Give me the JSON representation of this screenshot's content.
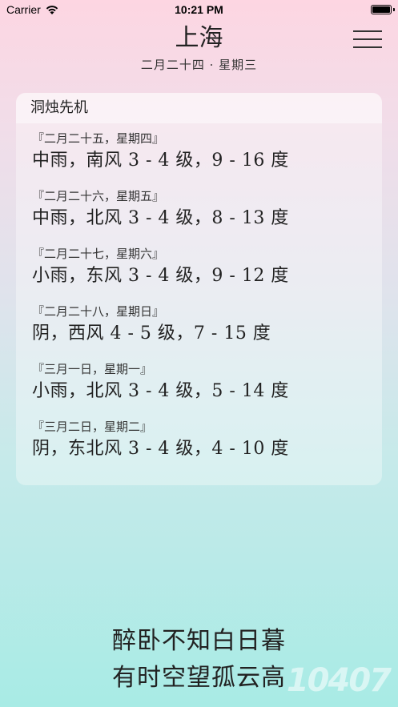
{
  "status_bar": {
    "carrier": "Carrier",
    "time": "10:21 PM"
  },
  "header": {
    "city": "上海",
    "date": "二月二十四 · 星期三"
  },
  "card": {
    "title": "洞烛先机",
    "forecast": [
      {
        "date": "『二月二十五，星期四』",
        "weather": "中雨，南风 3 - 4 级，9 - 16 度"
      },
      {
        "date": "『二月二十六，星期五』",
        "weather": "中雨，北风 3 - 4 级，8 - 13 度"
      },
      {
        "date": "『二月二十七，星期六』",
        "weather": "小雨，东风 3 - 4 级，9 - 12 度"
      },
      {
        "date": "『二月二十八，星期日』",
        "weather": "阴，西风 4 - 5 级，7 - 15 度"
      },
      {
        "date": "『三月一日，星期一』",
        "weather": "小雨，北风 3 - 4 级，5 - 14 度"
      },
      {
        "date": "『三月二日，星期二』",
        "weather": "阴，东北风 3 - 4 级，4 - 10 度"
      }
    ]
  },
  "poem": {
    "line1": "醉卧不知白日暮",
    "line2": "有时空望孤云高"
  },
  "watermark": "10407",
  "colors": {
    "gradient_top": "#fdd6e2",
    "gradient_bottom": "#a8ebe5"
  }
}
